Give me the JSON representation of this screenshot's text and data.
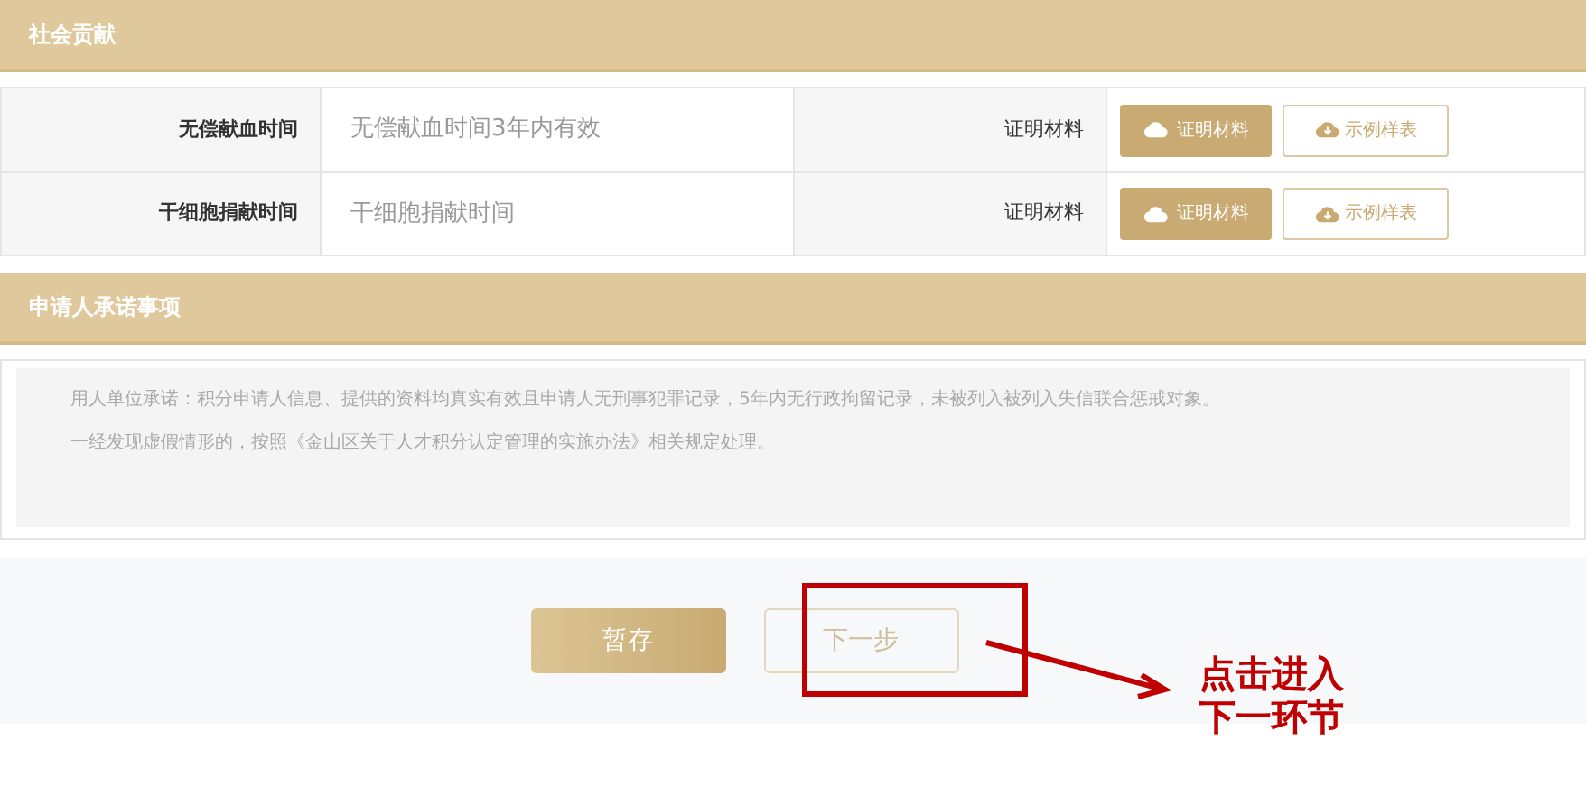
{
  "sections": [
    {
      "title": "社会贡献"
    },
    {
      "title": "申请人承诺事项"
    }
  ],
  "rows": [
    {
      "label": "无偿献血时间",
      "value": "无偿献血时间3年内有效",
      "material_label": "证明材料",
      "upload_button": "证明材料",
      "sample_button": "示例样表"
    },
    {
      "label": "干细胞捐献时间",
      "value": "干细胞捐献时间",
      "material_label": "证明材料",
      "upload_button": "证明材料",
      "sample_button": "示例样表"
    }
  ],
  "commitment": [
    "用人单位承诺：积分申请人信息、提供的资料均真实有效且申请人无刑事犯罪记录，5年内无行政拘留记录，未被列入被列入失信联合惩戒对象。",
    "一经发现虚假情形的，按照《金山区关于人才积分认定管理的实施办法》相关规定处理。"
  ],
  "buttons": {
    "save": "暂存",
    "next": "下一步"
  },
  "annotation": {
    "lines": [
      "点击进入",
      "下一环节"
    ]
  }
}
